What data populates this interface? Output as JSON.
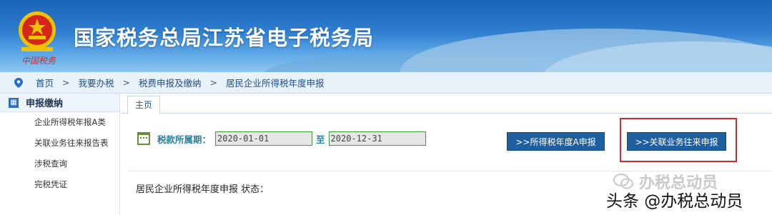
{
  "header": {
    "site_title": "国家税务总局江苏省电子税务局",
    "logo_text": "中国税务"
  },
  "breadcrumb": {
    "items": [
      "首页",
      "我要办税",
      "税费申报及缴纳",
      "居民企业所得税年度申报"
    ],
    "separator": ">"
  },
  "sidebar": {
    "section_title": "申报缴纳",
    "section_icon": "grid-icon",
    "items": [
      "企业所得税年报A类",
      "关联业务往来报告表",
      "涉税查询",
      "完税凭证"
    ]
  },
  "main": {
    "tab_label": "主页",
    "period_label": "税款所属期：",
    "period_start": "2020-01-01",
    "period_to": "至",
    "period_end": "2020-12-31",
    "btn_annual": ">>所得税年度A申报",
    "btn_related": ">>关联业务往来申报",
    "status_text": "居民企业所得税年度申报 状态："
  },
  "watermark": {
    "wechat": "办税总动员",
    "toutiao": "头条 @办税总动员"
  },
  "colors": {
    "banner_blue": "#1a63b8",
    "button_blue": "#1f5f9f",
    "highlight_red": "#e0232b",
    "field_border_green": "#3c9a3c"
  }
}
